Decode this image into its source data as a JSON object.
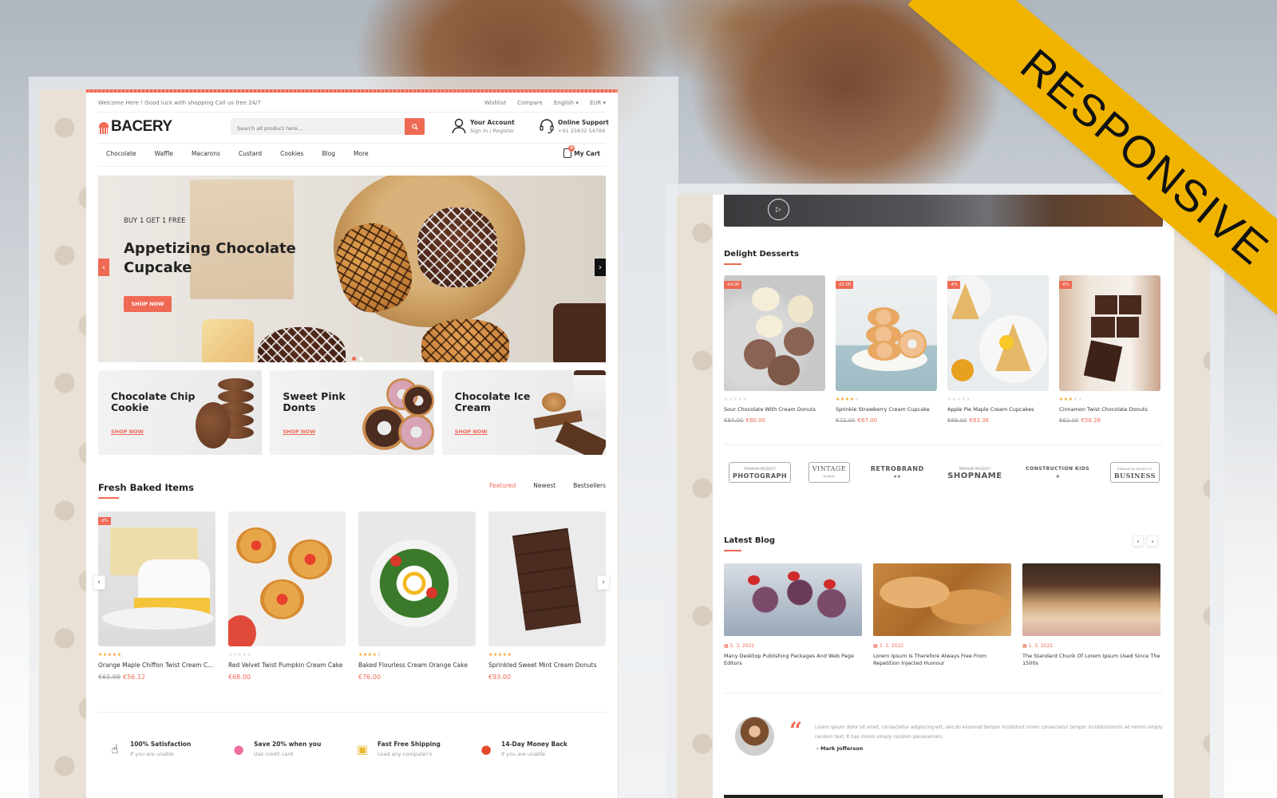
{
  "overlay": {
    "ribbon_text": "RESPONSIVE"
  },
  "desktop": {
    "topbar": {
      "welcome": "Welcome Here ! Good luck with shopping Call us free 24/7",
      "wishlist": "Wishlist",
      "compare": "Compare",
      "language": "English ▾",
      "currency": "EUR ▾"
    },
    "logo": "BACERY",
    "search": {
      "placeholder": "Search all product here..."
    },
    "account": {
      "title": "Your Account",
      "sub": "Sign In / Register"
    },
    "support": {
      "title": "Online Support",
      "sub": "+91 25832 54789"
    },
    "nav": [
      "Chocolate",
      "Waffle",
      "Macarons",
      "Custard",
      "Cookies",
      "Blog",
      "More"
    ],
    "cart": {
      "label": "My Cart",
      "count": "0"
    },
    "hero": {
      "subtitle": "BUY 1 GET 1 FREE",
      "title": "Appetizing Chocolate Cupcake",
      "button": "SHOP NOW",
      "prev": "‹",
      "next": "›"
    },
    "banners": [
      {
        "title": "Chocolate Chip Cookie",
        "link": "SHOP NOW"
      },
      {
        "title": "Sweet Pink Donts",
        "link": "SHOP NOW"
      },
      {
        "title": "Chocolate Ice Cream",
        "link": "SHOP NOW"
      }
    ],
    "fresh": {
      "title": "Fresh Baked Items",
      "tabs": [
        "Featured",
        "Newest",
        "Bestsellers"
      ],
      "active_tab": "Featured",
      "products": [
        {
          "name": "Orange Maple Chiffon Twist Cream C...",
          "old_price": "€61.00",
          "price": "€56.12",
          "badge": "-8%",
          "rating": 5
        },
        {
          "name": "Red Velvet Twist Pumpkin Cream Cake",
          "old_price": "",
          "price": "€68.00",
          "badge": "",
          "rating": 0
        },
        {
          "name": "Baked Flourless Cream Orange Cake",
          "old_price": "",
          "price": "€76.00",
          "badge": "",
          "rating": 4
        },
        {
          "name": "Sprinkled Sweet Mint Cream Donuts",
          "old_price": "",
          "price": "€93.00",
          "badge": "",
          "rating": 5
        }
      ]
    },
    "features": [
      {
        "icon": "satisfaction-icon",
        "title": "100% Satisfaction",
        "sub": "If you are unable"
      },
      {
        "icon": "piggy-bank-icon",
        "title": "Save 20% when you",
        "sub": "Use credit card"
      },
      {
        "icon": "delivery-scooter-icon",
        "title": "Fast Free Shipping",
        "sub": "Load any computer's"
      },
      {
        "icon": "money-bag-icon",
        "title": "14-Day Money Back",
        "sub": "If you are unable"
      }
    ]
  },
  "tablet": {
    "delight": {
      "title": "Delight Desserts",
      "products": [
        {
          "name": "Sour Chocolate With Cream Donuts",
          "old_price": "€84.00",
          "price": "€80.00",
          "badge": "-€4.00",
          "rating": 0
        },
        {
          "name": "Sprinkle Strawberry Cream Cupcake",
          "old_price": "€72.00",
          "price": "€67.00",
          "badge": "-€5.00",
          "rating": 4
        },
        {
          "name": "Apple Pie Maple Cream Cupcakes",
          "old_price": "€66.00",
          "price": "€63.36",
          "badge": "-4%",
          "rating": 0
        },
        {
          "name": "Cinnamon Twist Chocolate Donuts",
          "old_price": "€62.00",
          "price": "€58.28",
          "badge": "-6%",
          "rating": 3
        }
      ]
    },
    "brands": [
      "PHOTOGRAPH",
      "VINTAGE",
      "RETROBRAND",
      "SHOPNAME",
      "CONSTRUCTION KIDS",
      "BUSINESS"
    ],
    "blog": {
      "title": "Latest Blog",
      "posts": [
        {
          "date": "5. 3. 2022",
          "title": "Many Desktop Publishing Packages And Web Page Editors"
        },
        {
          "date": "3. 3. 2022",
          "title": "Lorem Ipsum Is Therefore Always Free From Repetition Injected Humour"
        },
        {
          "date": "1. 3. 2022",
          "title": "The Standard Chunk Of Lorem Ipsum Used Since The 1500s"
        }
      ]
    },
    "testimonial": {
      "text": "Lorem ipsum dolor sit amet, consectetur adipiscing elit, sed do eiusmod tempor incididunt lorem consectetur tempor incididuntenim ad minim simply random text. It has minim simply random pieceveniam.",
      "author": "- Mark Jofferson"
    }
  },
  "colors": {
    "accent": "#ef6a55",
    "ribbon": "#f0b400",
    "star": "#f5a623"
  }
}
